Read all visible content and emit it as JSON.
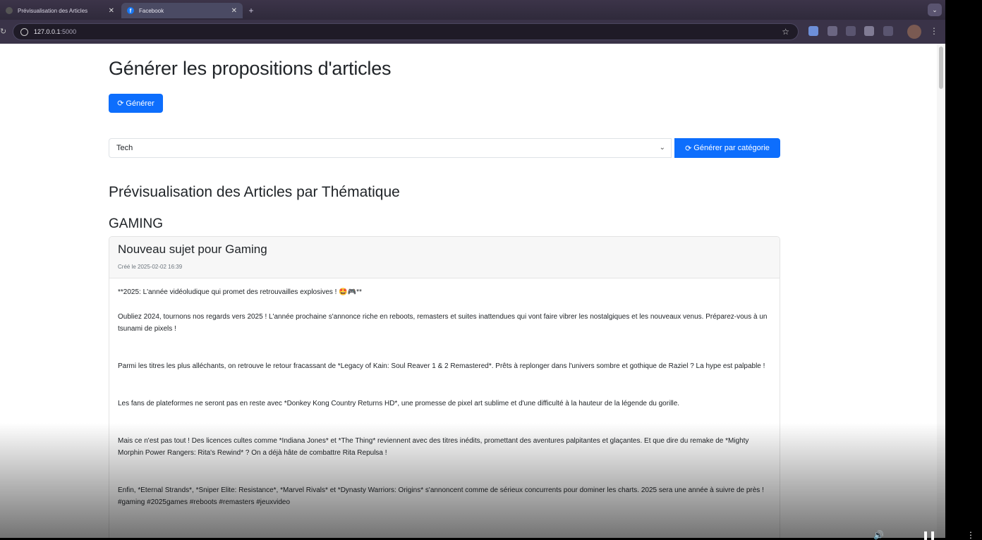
{
  "browser": {
    "tabs": [
      {
        "title": "Prévisualisation des Articles",
        "active": false
      },
      {
        "title": "Facebook",
        "active": true,
        "favicon": "f"
      }
    ],
    "new_tab": "+",
    "tab_menu": "⌄",
    "url_host": "127.0.0.1",
    "url_port": ":5000",
    "bookmark_icon": "☆",
    "menu_icon": "⋮"
  },
  "page": {
    "title": "Générer les propositions d'articles",
    "generate_button": "Générer",
    "category_select": {
      "selected": "Tech"
    },
    "generate_category_button": "Générer par catégorie",
    "preview_heading": "Prévisualisation des Articles par Thématique",
    "category_heading": "GAMING",
    "card": {
      "title": "Nouveau sujet pour Gaming",
      "date": "Créé le 2025-02-02 16:39",
      "paragraphs": [
        "**2025: L'année vidéoludique qui promet des retrouvailles explosives ! 🤩🎮**",
        "Oubliez 2024, tournons nos regards vers 2025 !  L'année prochaine s'annonce riche en reboots, remasters et suites inattendues qui vont faire vibrer les nostalgiques et les nouveaux venus.  Préparez-vous à un tsunami de pixels !",
        "Parmi les titres les plus alléchants, on retrouve le retour fracassant de *Legacy of Kain: Soul Reaver 1 & 2 Remastered*.  Prêts à replonger dans l'univers sombre et gothique de Raziel ?  La hype est palpable !",
        "Les fans de plateformes ne seront pas en reste avec *Donkey Kong Country Returns HD*, une promesse de pixel art sublime et d'une difficulté à la hauteur de la légende du gorille.",
        "Mais ce n'est pas tout !  Des licences cultes comme *Indiana Jones* et *The Thing* reviennent avec des titres inédits, promettant des aventures palpitantes et glaçantes.  Et que dire du remake de *Mighty Morphin Power Rangers: Rita's Rewind* ? On a déjà hâte de combattre Rita Repulsa !",
        "Enfin,  *Eternal Strands*, *Sniper Elite: Resistance*, *Marvel Rivals* et *Dynasty Warriors: Origins* s'annoncent comme de sérieux concurrents pour dominer les charts. 2025 sera une année à suivre de près !  #gaming #2025games #reboots #remasters #jeuxvideo"
      ]
    }
  },
  "colors": {
    "primary": "#0d6efd",
    "chrome_bg": "#3a3348"
  }
}
